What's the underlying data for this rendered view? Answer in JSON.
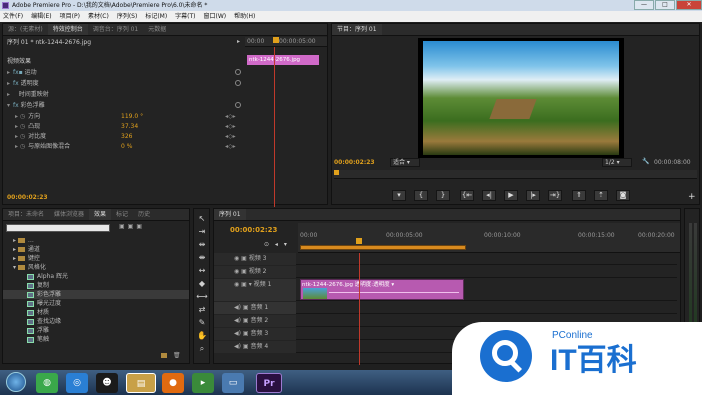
{
  "window": {
    "title": "Adobe Premiere Pro - D:\\我的文档\\Adobe\\Premiere Pro\\6.0\\未命名 *",
    "minimize": "—",
    "maximize": "□",
    "close": "✕"
  },
  "menu": [
    "文件(F)",
    "编辑(E)",
    "项目(P)",
    "素材(C)",
    "序列(S)",
    "标记(M)",
    "字幕(T)",
    "窗口(W)",
    "帮助(H)"
  ],
  "source_tabs": [
    "源：(无素材)",
    "特效控制台",
    "调音台：序列 01",
    "元数据"
  ],
  "effect_controls": {
    "header": "序列 01 * ntk-1244-2676.jpg",
    "ruler": [
      "00:00",
      "00:00:05:00"
    ],
    "clip_label": "ntk-1244-2676.jpg",
    "section": "视频效果",
    "items": [
      {
        "label": "运动",
        "name": "effect-motion"
      },
      {
        "label": "透明度",
        "name": "effect-opacity"
      },
      {
        "label": "时间重映射",
        "name": "effect-time-remap"
      },
      {
        "label": "彩色浮雕",
        "name": "effect-color-emboss"
      }
    ],
    "params": [
      {
        "label": "方向",
        "value": "119.0 °"
      },
      {
        "label": "凸现",
        "value": "37.34"
      },
      {
        "label": "对比度",
        "value": "326"
      },
      {
        "label": "与原始图像混合",
        "value": "0 %"
      }
    ],
    "timecode": "00:00:02:23"
  },
  "program": {
    "tab": "节目：序列 01",
    "timecode_left": "00:00:02:23",
    "fit": "适合",
    "fraction": "1/2",
    "timecode_right": "00:00:08:00"
  },
  "project_tabs": [
    "项目：未命名",
    "媒体浏览器",
    "效果",
    "标记",
    "历史"
  ],
  "effects_list": [
    {
      "label": "通道",
      "type": "folder"
    },
    {
      "label": "键控",
      "type": "folder"
    },
    {
      "label": "风格化",
      "type": "folder"
    },
    {
      "label": "Alpha 辉光",
      "type": "fx"
    },
    {
      "label": "复制",
      "type": "fx"
    },
    {
      "label": "彩色浮雕",
      "type": "fx"
    },
    {
      "label": "曝光过度",
      "type": "fx"
    },
    {
      "label": "材质",
      "type": "fx"
    },
    {
      "label": "查找边缘",
      "type": "fx"
    },
    {
      "label": "浮雕",
      "type": "fx"
    },
    {
      "label": "笔触",
      "type": "fx"
    }
  ],
  "timeline": {
    "tab": "序列 01",
    "timecode": "00:00:02:23",
    "ruler": [
      "00:00",
      "00:00:05:00",
      "00:00:10:00",
      "00:00:15:00",
      "00:00:20:00"
    ],
    "tracks": [
      {
        "label": "视频 3"
      },
      {
        "label": "视频 2"
      },
      {
        "label": "视频 1"
      },
      {
        "label": "音频 1"
      },
      {
        "label": "音频 2"
      },
      {
        "label": "音频 3"
      },
      {
        "label": "音频 4"
      }
    ],
    "clip_label": "ntk-1244-2676.jpg 透明度:透明度 ▾"
  },
  "watermark": {
    "brand": "PConline",
    "text": "IT百科"
  },
  "taskbar": {
    "app_label": "Pr"
  }
}
